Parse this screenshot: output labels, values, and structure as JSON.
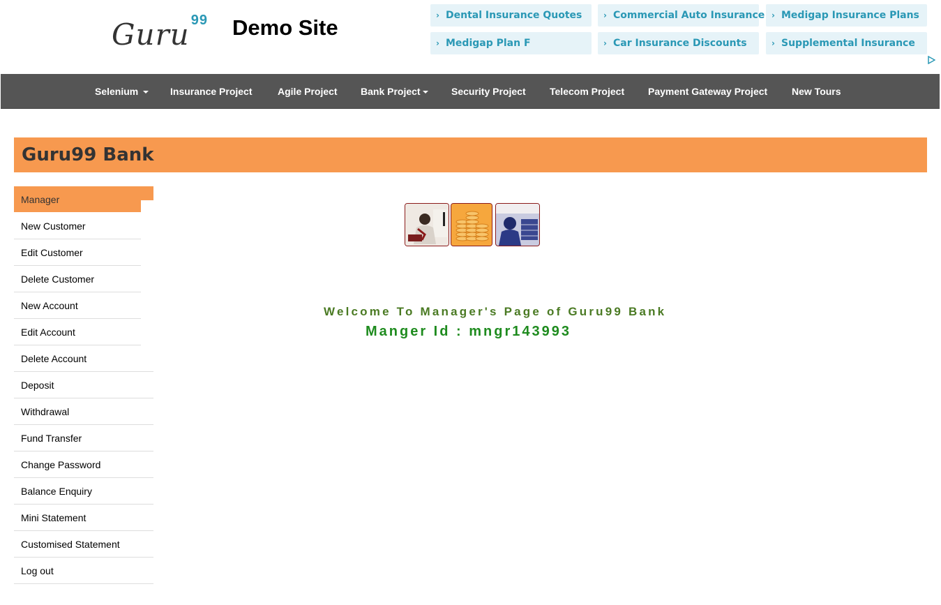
{
  "logo": {
    "text": "Guru",
    "superscript": "99"
  },
  "site_title": "Demo Site",
  "ads": [
    "Dental Insurance Quotes",
    "Commercial Auto Insurance",
    "Medigap Insurance Plans",
    "Medigap Plan F",
    "Car Insurance Discounts",
    "Supplemental Insurance"
  ],
  "nav": [
    "Selenium",
    "Insurance Project",
    "Agile Project",
    "Bank Project",
    "Security Project",
    "Telecom Project",
    "Payment Gateway Project",
    "New Tours"
  ],
  "bank_title": "Guru99 Bank",
  "menu": {
    "header": "Manager",
    "items": [
      "New Customer",
      "Edit Customer",
      "Delete Customer",
      "New Account",
      "Edit Account",
      "Delete Account",
      "Deposit",
      "Withdrawal",
      "Fund Transfer",
      "Change Password",
      "Balance Enquiry",
      "Mini Statement",
      "Customised Statement",
      "Log out"
    ]
  },
  "welcome": "Welcome To Manager's Page of Guru99 Bank",
  "manager_id": "Manger Id : mngr143993",
  "colors": {
    "accent_orange": "#f7994f",
    "nav_bg": "#555555",
    "ad_text": "#2a98b5",
    "welcome_green": "#4a7a23",
    "id_green": "#1e8b1e"
  }
}
